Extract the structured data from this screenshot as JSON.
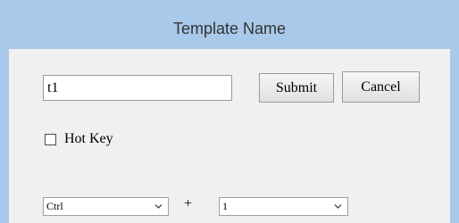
{
  "dialog": {
    "title": "Template Name"
  },
  "form": {
    "name_value": "t1",
    "submit_label": "Submit",
    "cancel_label": "Cancel",
    "hotkey_label": "Hot Key",
    "hotkey_checked": false,
    "modifier_selected": "Ctrl",
    "plus_label": "+",
    "key_selected": "1"
  },
  "colors": {
    "titlebar_bg": "#a9c9ea",
    "body_bg": "#f0f0f0"
  },
  "icons": {
    "dropdown": "chevron-down-icon"
  }
}
